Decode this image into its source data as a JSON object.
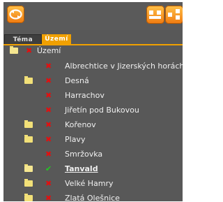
{
  "tabs": [
    {
      "label": "Téma"
    },
    {
      "label": "Území"
    }
  ],
  "tree": {
    "root": {
      "label": "Území",
      "mark": "✖",
      "icon": "folder-open-icon"
    },
    "items": [
      {
        "label": "Albrechtice v Jizerských horách",
        "mark": "✖",
        "folder": false,
        "selected": false
      },
      {
        "label": "Desná",
        "mark": "✖",
        "folder": true,
        "selected": false
      },
      {
        "label": "Harrachov",
        "mark": "✖",
        "folder": false,
        "selected": false
      },
      {
        "label": "Jiřetín pod Bukovou",
        "mark": "✖",
        "folder": false,
        "selected": false
      },
      {
        "label": "Kořenov",
        "mark": "✖",
        "folder": true,
        "selected": false
      },
      {
        "label": "Plavy",
        "mark": "✖",
        "folder": true,
        "selected": false
      },
      {
        "label": "Smržovka",
        "mark": "✖",
        "folder": false,
        "selected": false
      },
      {
        "label": "Tanvald",
        "mark": "✔",
        "folder": true,
        "selected": true
      },
      {
        "label": "Velké Hamry",
        "mark": "✖",
        "folder": true,
        "selected": false
      },
      {
        "label": "Zlatá Olešnice",
        "mark": "✖",
        "folder": true,
        "selected": false
      }
    ]
  },
  "colors": {
    "panel": "#585858",
    "accent": "#f0a000",
    "text": "#f0f0f0",
    "cross": "#e11010",
    "check": "#22c822"
  }
}
